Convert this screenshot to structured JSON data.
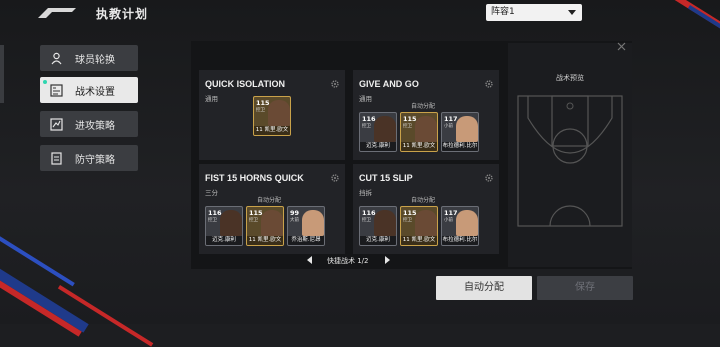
{
  "header": {
    "title": "执教计划",
    "lineup_select": {
      "value": "阵容1"
    }
  },
  "sidebar": {
    "items": [
      {
        "label": "球员轮换",
        "icon": "rotation-icon",
        "active": false
      },
      {
        "label": "战术设置",
        "icon": "tactics-icon",
        "active": true
      },
      {
        "label": "进攻策略",
        "icon": "offense-icon",
        "active": false
      },
      {
        "label": "防守策略",
        "icon": "defense-icon",
        "active": false
      }
    ]
  },
  "tactics": [
    {
      "name": "QUICK ISOLATION",
      "type": "通用",
      "auto_label": "",
      "players": [
        {
          "ovr": "115",
          "pos": "控卫",
          "num": "11",
          "name": "11 凯里.欧文",
          "card": "gold"
        }
      ]
    },
    {
      "name": "GIVE AND GO",
      "type": "通用",
      "auto_label": "自动分配",
      "players": [
        {
          "ovr": "116",
          "pos": "控卫",
          "num": "",
          "name": "迈克.康利",
          "card": "gray"
        },
        {
          "ovr": "115",
          "pos": "控卫",
          "num": "11",
          "name": "11 凯里.欧文",
          "card": "gold"
        },
        {
          "ovr": "117",
          "pos": "小前",
          "num": "",
          "name": "布拉德利.比尔",
          "card": "gray"
        }
      ]
    },
    {
      "name": "FIST 15 HORNS QUICK",
      "type": "三分",
      "auto_label": "自动分配",
      "players": [
        {
          "ovr": "116",
          "pos": "控卫",
          "num": "",
          "name": "迈克.康利",
          "card": "gray"
        },
        {
          "ovr": "115",
          "pos": "控卫",
          "num": "11",
          "name": "11 凯里.欧文",
          "card": "gold"
        },
        {
          "ovr": "99",
          "pos": "大前",
          "num": "",
          "name": "乔治斯.尼昂",
          "card": "gray"
        }
      ]
    },
    {
      "name": "CUT 15 SLIP",
      "type": "挡拆",
      "auto_label": "自动分配",
      "players": [
        {
          "ovr": "116",
          "pos": "控卫",
          "num": "",
          "name": "迈克.康利",
          "card": "gray"
        },
        {
          "ovr": "115",
          "pos": "控卫",
          "num": "11",
          "name": "11 凯里.欧文",
          "card": "gold"
        },
        {
          "ovr": "117",
          "pos": "小前",
          "num": "",
          "name": "布拉德利.比尔",
          "card": "gray"
        }
      ]
    }
  ],
  "preview": {
    "label": "战术预览"
  },
  "pagination": {
    "label": "快捷战术 1/2"
  },
  "buttons": {
    "auto_assign": "自动分配",
    "save": "保存"
  },
  "colors": {
    "active_tab": "#e9e9e9",
    "gold_card": "#c9a24a",
    "accent_dot": "#2fd6b0"
  }
}
